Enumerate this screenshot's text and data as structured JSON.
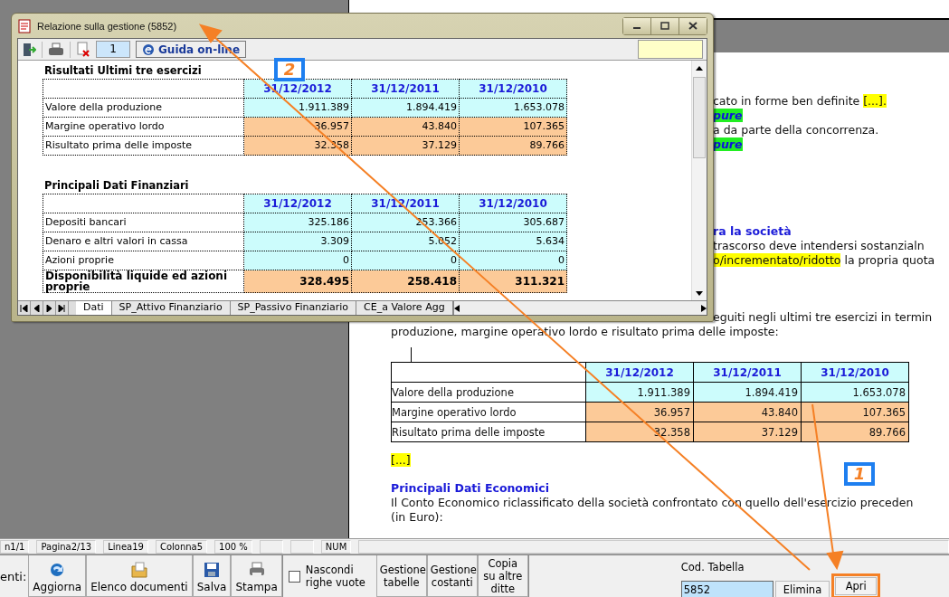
{
  "window": {
    "title": "Relazione sulla gestione (5852)",
    "toolbar": {
      "page_field": "1",
      "help_button": "Guida on-line"
    },
    "sections": [
      {
        "title": "Risultati Ultimi tre esercizi",
        "columns": [
          "31/12/2012",
          "31/12/2011",
          "31/12/2010"
        ],
        "rows": [
          {
            "label": "Valore della produzione",
            "values": [
              "1.911.389",
              "1.894.419",
              "1.653.078"
            ],
            "color": "#ccfcfc",
            "bold": false
          },
          {
            "label": "Margine operativo lordo",
            "values": [
              "36.957",
              "43.840",
              "107.365"
            ],
            "color": "#fcca98",
            "bold": false
          },
          {
            "label": "Risultato prima delle imposte",
            "values": [
              "32.358",
              "37.129",
              "89.766"
            ],
            "color": "#fcca98",
            "bold": false
          }
        ]
      },
      {
        "title": "Principali Dati Finanziari",
        "columns": [
          "31/12/2012",
          "31/12/2011",
          "31/12/2010"
        ],
        "rows": [
          {
            "label": "Depositi bancari",
            "values": [
              "325.186",
              "253.366",
              "305.687"
            ],
            "color": "#ccfcfc",
            "bold": false
          },
          {
            "label": "Denaro e altri valori in cassa",
            "values": [
              "3.309",
              "5.052",
              "5.634"
            ],
            "color": "#ccfcfc",
            "bold": false
          },
          {
            "label": "Azioni proprie",
            "values": [
              "0",
              "0",
              "0"
            ],
            "color": "#ccfcfc",
            "bold": false
          },
          {
            "label": "Disponibilità liquide ed azioni proprie",
            "values": [
              "328.495",
              "258.418",
              "311.321"
            ],
            "color": "#fcca98",
            "bold": true
          }
        ]
      }
    ],
    "sheet_tabs": [
      {
        "label": "Dati",
        "selected": true
      },
      {
        "label": "SP_Attivo Finanziario",
        "selected": false
      },
      {
        "label": "SP_Passivo Finanziario",
        "selected": false
      },
      {
        "label": "CE_a Valore Agg",
        "selected": false
      }
    ]
  },
  "document": {
    "beside_window": [
      {
        "lines": [
          [
            {
              "kind": "plain",
              "text": "cato in forme ben definite "
            },
            {
              "kind": "mark",
              "text": "[...]."
            }
          ],
          [
            {
              "kind": "tag",
              "text": "pure"
            }
          ],
          [
            {
              "kind": "plain",
              "text": "a da parte della concorrenza."
            }
          ],
          [
            {
              "kind": "tag",
              "text": "pure"
            }
          ]
        ]
      },
      {
        "lines": [
          [
            {
              "kind": "heading",
              "text": "ra la società"
            }
          ],
          [
            {
              "kind": "plain",
              "text": "trascorso deve intendersi sostanzialn"
            }
          ],
          [
            {
              "kind": "mark",
              "text": "o/incrementato/ridotto"
            },
            {
              "kind": "plain",
              "text": " la propria quota"
            }
          ]
        ]
      },
      {
        "lines": [
          [
            {
              "kind": "plain",
              "text": "eguiti negli ultimi tre esercizi in termin"
            }
          ]
        ]
      }
    ],
    "lines_before_table": [
      [
        {
          "kind": "plain",
          "text": "produzione, margine operativo lordo e risultato prima delle imposte:"
        }
      ]
    ],
    "table": {
      "columns": [
        "31/12/2012",
        "31/12/2011",
        "31/12/2010"
      ],
      "rows": [
        {
          "label": "Valore della produzione",
          "values": [
            "1.911.389",
            "1.894.419",
            "1.653.078"
          ],
          "color": "#ccfcfc"
        },
        {
          "label": "Margine operativo lordo",
          "values": [
            "36.957",
            "43.840",
            "107.365"
          ],
          "color": "#fcca98"
        },
        {
          "label": "Risultato prima delle imposte",
          "values": [
            "32.358",
            "37.129",
            "89.766"
          ],
          "color": "#fcca98"
        }
      ]
    },
    "lines_after_table": [
      [
        {
          "kind": "mark",
          "text": "[...]"
        }
      ],
      [
        {
          "kind": "heading",
          "text": "Principali Dati Economici"
        }
      ],
      [
        {
          "kind": "plain",
          "text": "Il Conto Economico riclassificato della società confrontato con quello dell'esercizio preceden"
        }
      ],
      [
        {
          "kind": "plain",
          "text": "(in Euro):"
        }
      ]
    ]
  },
  "status_bar": {
    "fields": [
      "n1/1",
      "Pagina2/13",
      "Linea19",
      "Colonna5",
      "100 %"
    ],
    "indicators": [
      "NUM"
    ]
  },
  "toolbar": {
    "label": "enti:",
    "buttons": [
      {
        "label": "Aggiorna",
        "kind": "refresh"
      },
      {
        "label": "Elenco documenti",
        "kind": "folder"
      },
      {
        "label": "Salva",
        "kind": "save"
      },
      {
        "label": "Stampa",
        "kind": "print"
      }
    ],
    "hide_empty_rows": {
      "label": "Nascondi righe vuote",
      "checked": false
    },
    "text_buttons": [
      "Gestione tabelle",
      "Gestione costanti",
      "Copia su altre ditte"
    ],
    "table_code": {
      "label": "Cod. Tabella",
      "value": "5852"
    },
    "delete_button": "Elimina",
    "open_button": "Apri"
  },
  "annotations": [
    {
      "label": "2"
    },
    {
      "label": "1"
    }
  ]
}
